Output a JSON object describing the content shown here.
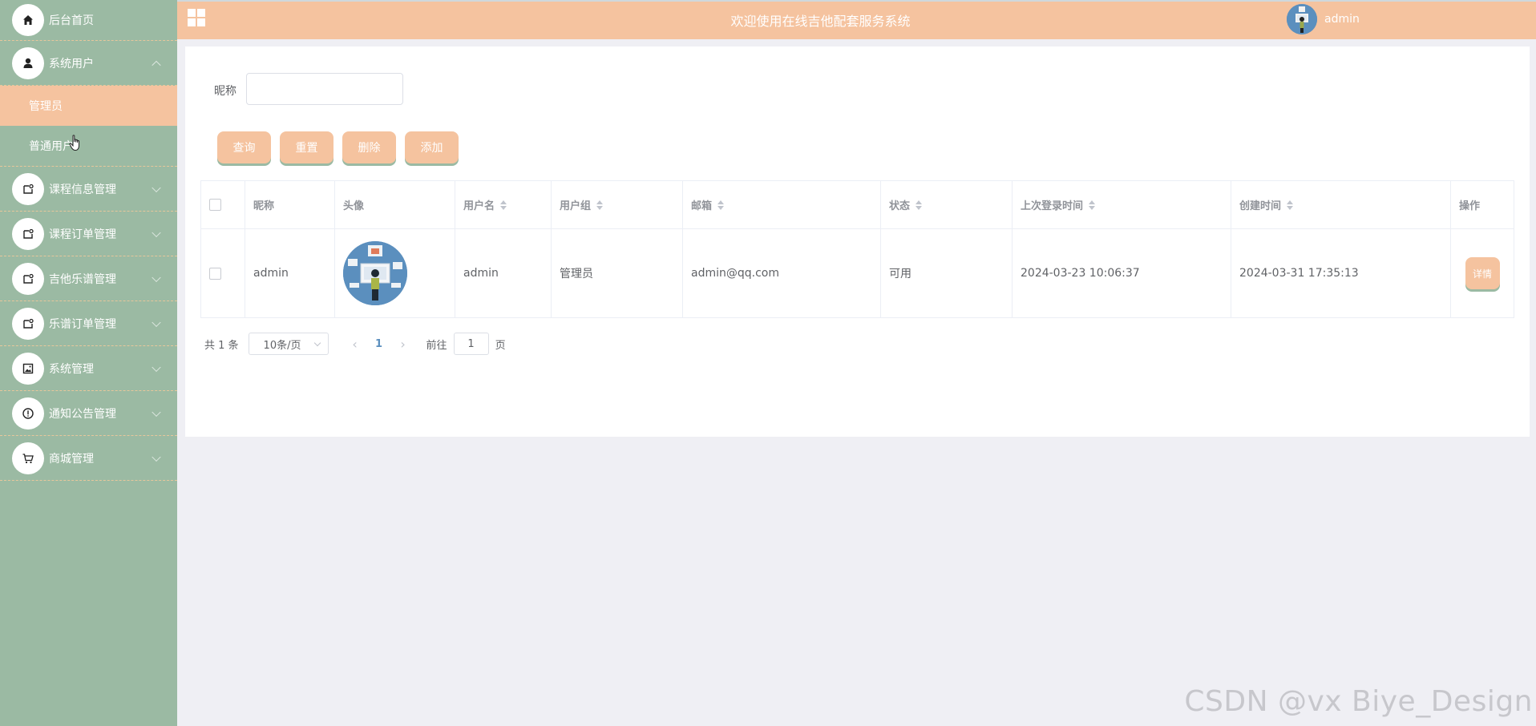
{
  "sidebar": {
    "items": [
      {
        "label": "后台首页",
        "icon": "home-icon"
      },
      {
        "label": "系统用户",
        "icon": "user-icon",
        "expanded": true,
        "children": [
          {
            "label": "管理员",
            "active": true
          },
          {
            "label": "普通用户",
            "active": false
          }
        ]
      },
      {
        "label": "课程信息管理",
        "icon": "module-icon"
      },
      {
        "label": "课程订单管理",
        "icon": "module-icon"
      },
      {
        "label": "吉他乐谱管理",
        "icon": "module-icon"
      },
      {
        "label": "乐谱订单管理",
        "icon": "module-icon"
      },
      {
        "label": "系统管理",
        "icon": "image-icon"
      },
      {
        "label": "通知公告管理",
        "icon": "info-icon"
      },
      {
        "label": "商城管理",
        "icon": "cart-icon"
      }
    ]
  },
  "header": {
    "title": "欢迎使用在线吉他配套服务系统",
    "username": "admin"
  },
  "search": {
    "label": "昵称",
    "value": "",
    "placeholder": ""
  },
  "toolbar": {
    "query": "查询",
    "reset": "重置",
    "delete": "删除",
    "add": "添加"
  },
  "table": {
    "columns": [
      "昵称",
      "头像",
      "用户名",
      "用户组",
      "邮箱",
      "状态",
      "上次登录时间",
      "创建时间",
      "操作"
    ],
    "rows": [
      {
        "nickname": "admin",
        "username": "admin",
        "group": "管理员",
        "email": "admin@qq.com",
        "status": "可用",
        "last_login": "2024-03-23 10:06:37",
        "created": "2024-03-31 17:35:13",
        "action": "详情"
      }
    ]
  },
  "pagination": {
    "total": "共 1 条",
    "page_size": "10条/页",
    "current_page": "1",
    "goto_label": "前往",
    "goto_value": "1",
    "page_suffix": "页"
  },
  "watermark": "CSDN @vx Biye_Design",
  "colors": {
    "sidebar": "#9bbaa3",
    "accent": "#f5c39f",
    "background": "#efeff4"
  }
}
